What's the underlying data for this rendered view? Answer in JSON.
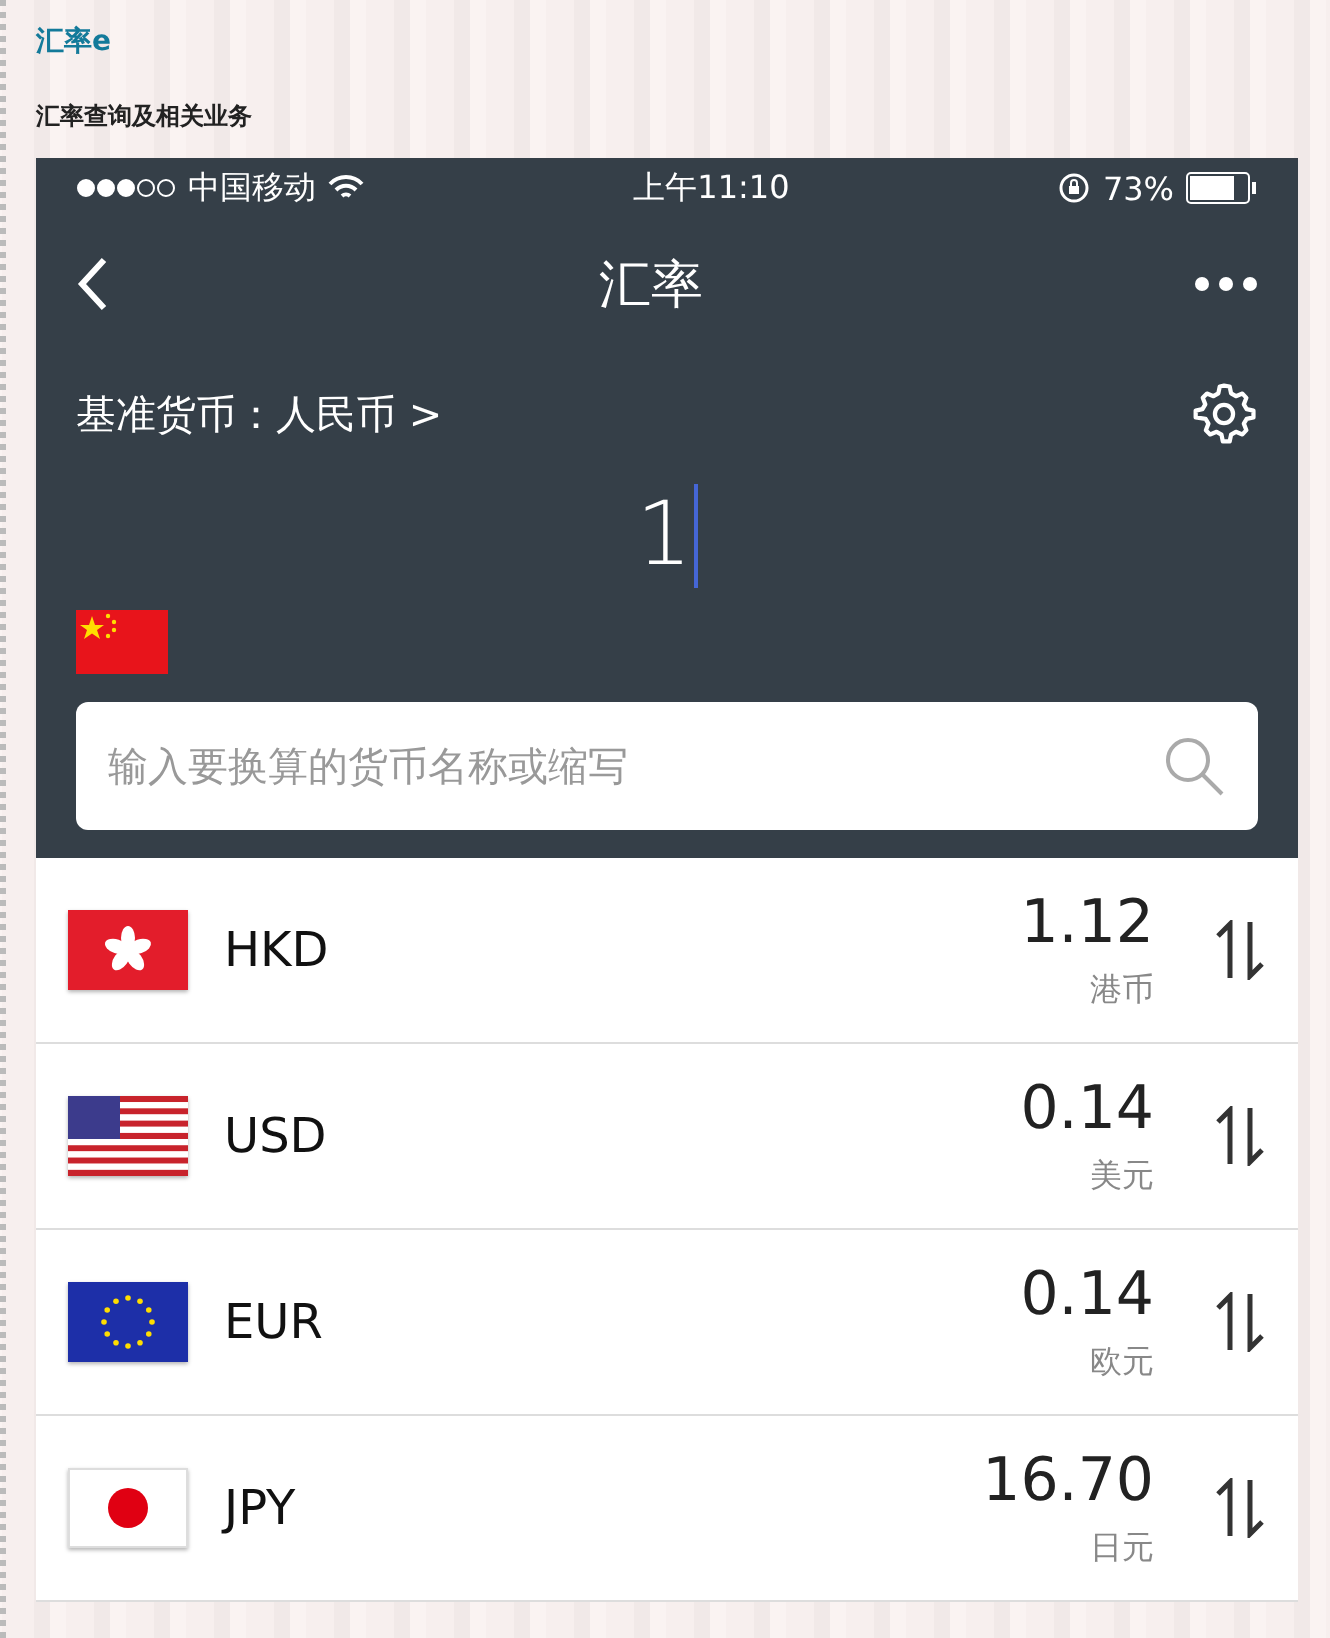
{
  "page": {
    "title": "汇率e",
    "subtitle": "汇率查询及相关业务"
  },
  "status_bar": {
    "carrier": "中国移动",
    "time": "上午11:10",
    "battery": "73%"
  },
  "nav": {
    "title": "汇率"
  },
  "base_currency": {
    "label": "基准货币：人民币 >"
  },
  "amount": {
    "value": "1"
  },
  "search": {
    "placeholder": "输入要换算的货币名称或缩写"
  },
  "rates": [
    {
      "kind": "hk",
      "code": "HKD",
      "value": "1.12",
      "name": "港币"
    },
    {
      "kind": "us",
      "code": "USD",
      "value": "0.14",
      "name": "美元"
    },
    {
      "kind": "eu",
      "code": "EUR",
      "value": "0.14",
      "name": "欧元"
    },
    {
      "kind": "jp",
      "code": "JPY",
      "value": "16.70",
      "name": "日元"
    }
  ]
}
